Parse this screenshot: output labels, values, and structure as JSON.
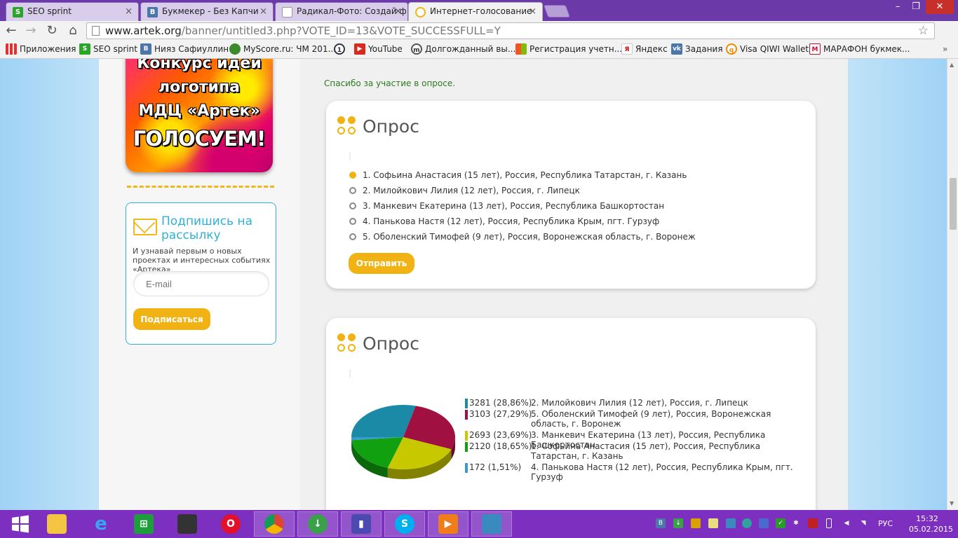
{
  "browser": {
    "tabs": [
      {
        "title": "SEO sprint",
        "icon": "seosprint-icon",
        "color": "#2aa52a"
      },
      {
        "title": "Букмекер - Без Капчи",
        "icon": "vk-icon",
        "color": "#4a76a8"
      },
      {
        "title": "Радикал-Фото: Создай ф",
        "icon": "page-icon",
        "color": "#999999"
      },
      {
        "title": "Интернет-голосование",
        "icon": "globe-icon",
        "color": "#f0b313"
      }
    ],
    "url_host": "www.artek.org",
    "url_path": "/banner/untitled3.php?VOTE_ID=13&VOTE_SUCCESSFULL=Y",
    "bookmarks": [
      {
        "label": "Приложения",
        "icon": "apps-icon"
      },
      {
        "label": "SEO sprint",
        "icon": "seosprint-icon"
      },
      {
        "label": "Нияз Сафиуллин",
        "icon": "vk-icon"
      },
      {
        "label": "MyScore.ru: ЧМ 201...",
        "icon": "myscore-icon"
      },
      {
        "label": "",
        "icon": "1x-icon"
      },
      {
        "label": "YouTube",
        "icon": "youtube-icon"
      },
      {
        "label": "Долгожданный вы...",
        "icon": "circle-m-icon"
      },
      {
        "label": "Регистрация учетн...",
        "icon": "windows-icon"
      },
      {
        "label": "Яндекс",
        "icon": "yandex-icon"
      },
      {
        "label": "Задания",
        "icon": "vk-icon"
      },
      {
        "label": "Visa QIWI Wallet",
        "icon": "qiwi-icon"
      },
      {
        "label": "МАРАФОН букмек...",
        "icon": "marathon-icon"
      }
    ]
  },
  "sidebar": {
    "banner_lines": [
      "Конкурс идей",
      "логотипа",
      "МДЦ «Артек»",
      "ГОЛОСУЕМ!"
    ],
    "subscribe": {
      "title": "Подпишись на рассылку",
      "description": "И узнавай первым о новых проектах и интересных событиях «Артека»",
      "email_placeholder": "E-mail",
      "button": "Подписаться"
    }
  },
  "main": {
    "thanks": "Спасибо за участие в опросе.",
    "poll_form": {
      "title": "Опрос",
      "options": [
        "1. Софьина Анастасия (15 лет), Россия, Республика Татарстан, г. Казань",
        "2. Милойкович Лилия (12 лет), Россия, г. Липецк",
        "3. Манкевич Екатерина (13 лет), Россия, Республика Башкортостан",
        "4. Панькова Настя (12 лет), Россия, Республика Крым, пгт. Гурзуф",
        "5. Оболенский Тимофей (9 лет), Россия, Воронежская область, г. Воронеж"
      ],
      "selected_index": 0,
      "submit": "Отправить"
    },
    "poll_results": {
      "title": "Опрос"
    }
  },
  "chart_data": {
    "type": "pie",
    "title": "",
    "series": [
      {
        "name": "2. Милойкович Лилия (12 лет), Россия, г. Липецк",
        "value": 3281,
        "label": "3281 (28,86%)",
        "color": "#1a8aa6"
      },
      {
        "name": "5. Оболенский Тимофей (9 лет), Россия, Воронежская область, г. Воронеж",
        "value": 3103,
        "label": "3103 (27,29%)",
        "color": "#a01040"
      },
      {
        "name": "3. Манкевич Екатерина (13 лет), Россия, Республика Башкортостан",
        "value": 2693,
        "label": "2693 (23,69%)",
        "color": "#c8c800"
      },
      {
        "name": "1. Софьина Анастасия (15 лет), Россия, Республика Татарстан, г. Казань",
        "value": 2120,
        "label": "2120 (18,65%)",
        "color": "#10a010"
      },
      {
        "name": "4. Панькова Настя (12 лет), Россия, Республика Крым, пгт. Гурзуф",
        "value": 172,
        "label": "172 (1,51%)",
        "color": "#3a9ad0"
      }
    ]
  },
  "taskbar": {
    "apps": [
      "explorer-icon",
      "ie-icon",
      "store-icon",
      "stealth-icon",
      "opera-icon",
      "chrome-icon",
      "download-icon",
      "signal-icon",
      "skype-icon",
      "video-icon",
      "photo-icon"
    ],
    "lang": "РУС",
    "time": "15:32",
    "date": "05.02.2015"
  },
  "colors": {
    "accent": "#f0b313",
    "link": "#2eb2d6",
    "taskbar": "#7d2fc0"
  }
}
